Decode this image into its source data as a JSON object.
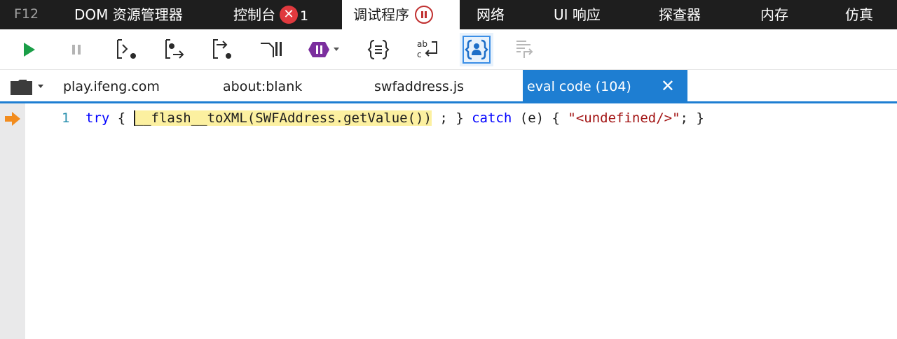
{
  "topbar": {
    "f12_label": "F12",
    "tabs": [
      {
        "label": "DOM 资源管理器"
      },
      {
        "label": "控制台",
        "error_icon": "✕",
        "error_count": "1"
      },
      {
        "label": "调试程序"
      },
      {
        "label": "网络"
      },
      {
        "label": "UI 响应"
      },
      {
        "label": "探查器"
      },
      {
        "label": "内存"
      },
      {
        "label": "仿真"
      }
    ],
    "active_tab": "调试程序"
  },
  "toolbar": {
    "buttons": [
      "continue-icon",
      "break-icon",
      "step-into-icon",
      "step-over-icon",
      "step-out-icon",
      "break-on-new-worker-icon",
      "exception-behavior-icon",
      "pretty-print-icon",
      "word-wrap-icon",
      "just-my-code-icon",
      "source-map-icon"
    ]
  },
  "file_tabs": {
    "tabs": [
      {
        "label": "play.ifeng.com"
      },
      {
        "label": "about:blank"
      },
      {
        "label": "swfaddress.js"
      },
      {
        "label": "eval code (104)"
      }
    ],
    "active_tab": "eval code (104)",
    "close_label": "✕"
  },
  "code": {
    "line_number": "1",
    "kw_try": "try",
    "brace_open": " { ",
    "highlight": "__flash__toXML(SWFAddress.getValue())",
    "after_highlight": " ; } ",
    "kw_catch": "catch",
    "catch_rest": " (e) { ",
    "string_value": "\"<undefined/>\"",
    "tail": "; }"
  },
  "colors": {
    "accent": "#1e7ed2",
    "topbar_bg": "#1e1e1e",
    "error_red": "#e0393e",
    "continue_green": "#1a9e47",
    "exception_purple": "#7b2f9e",
    "highlight_yellow": "#fcf0a0",
    "exec_arrow_orange": "#f28c1e"
  }
}
